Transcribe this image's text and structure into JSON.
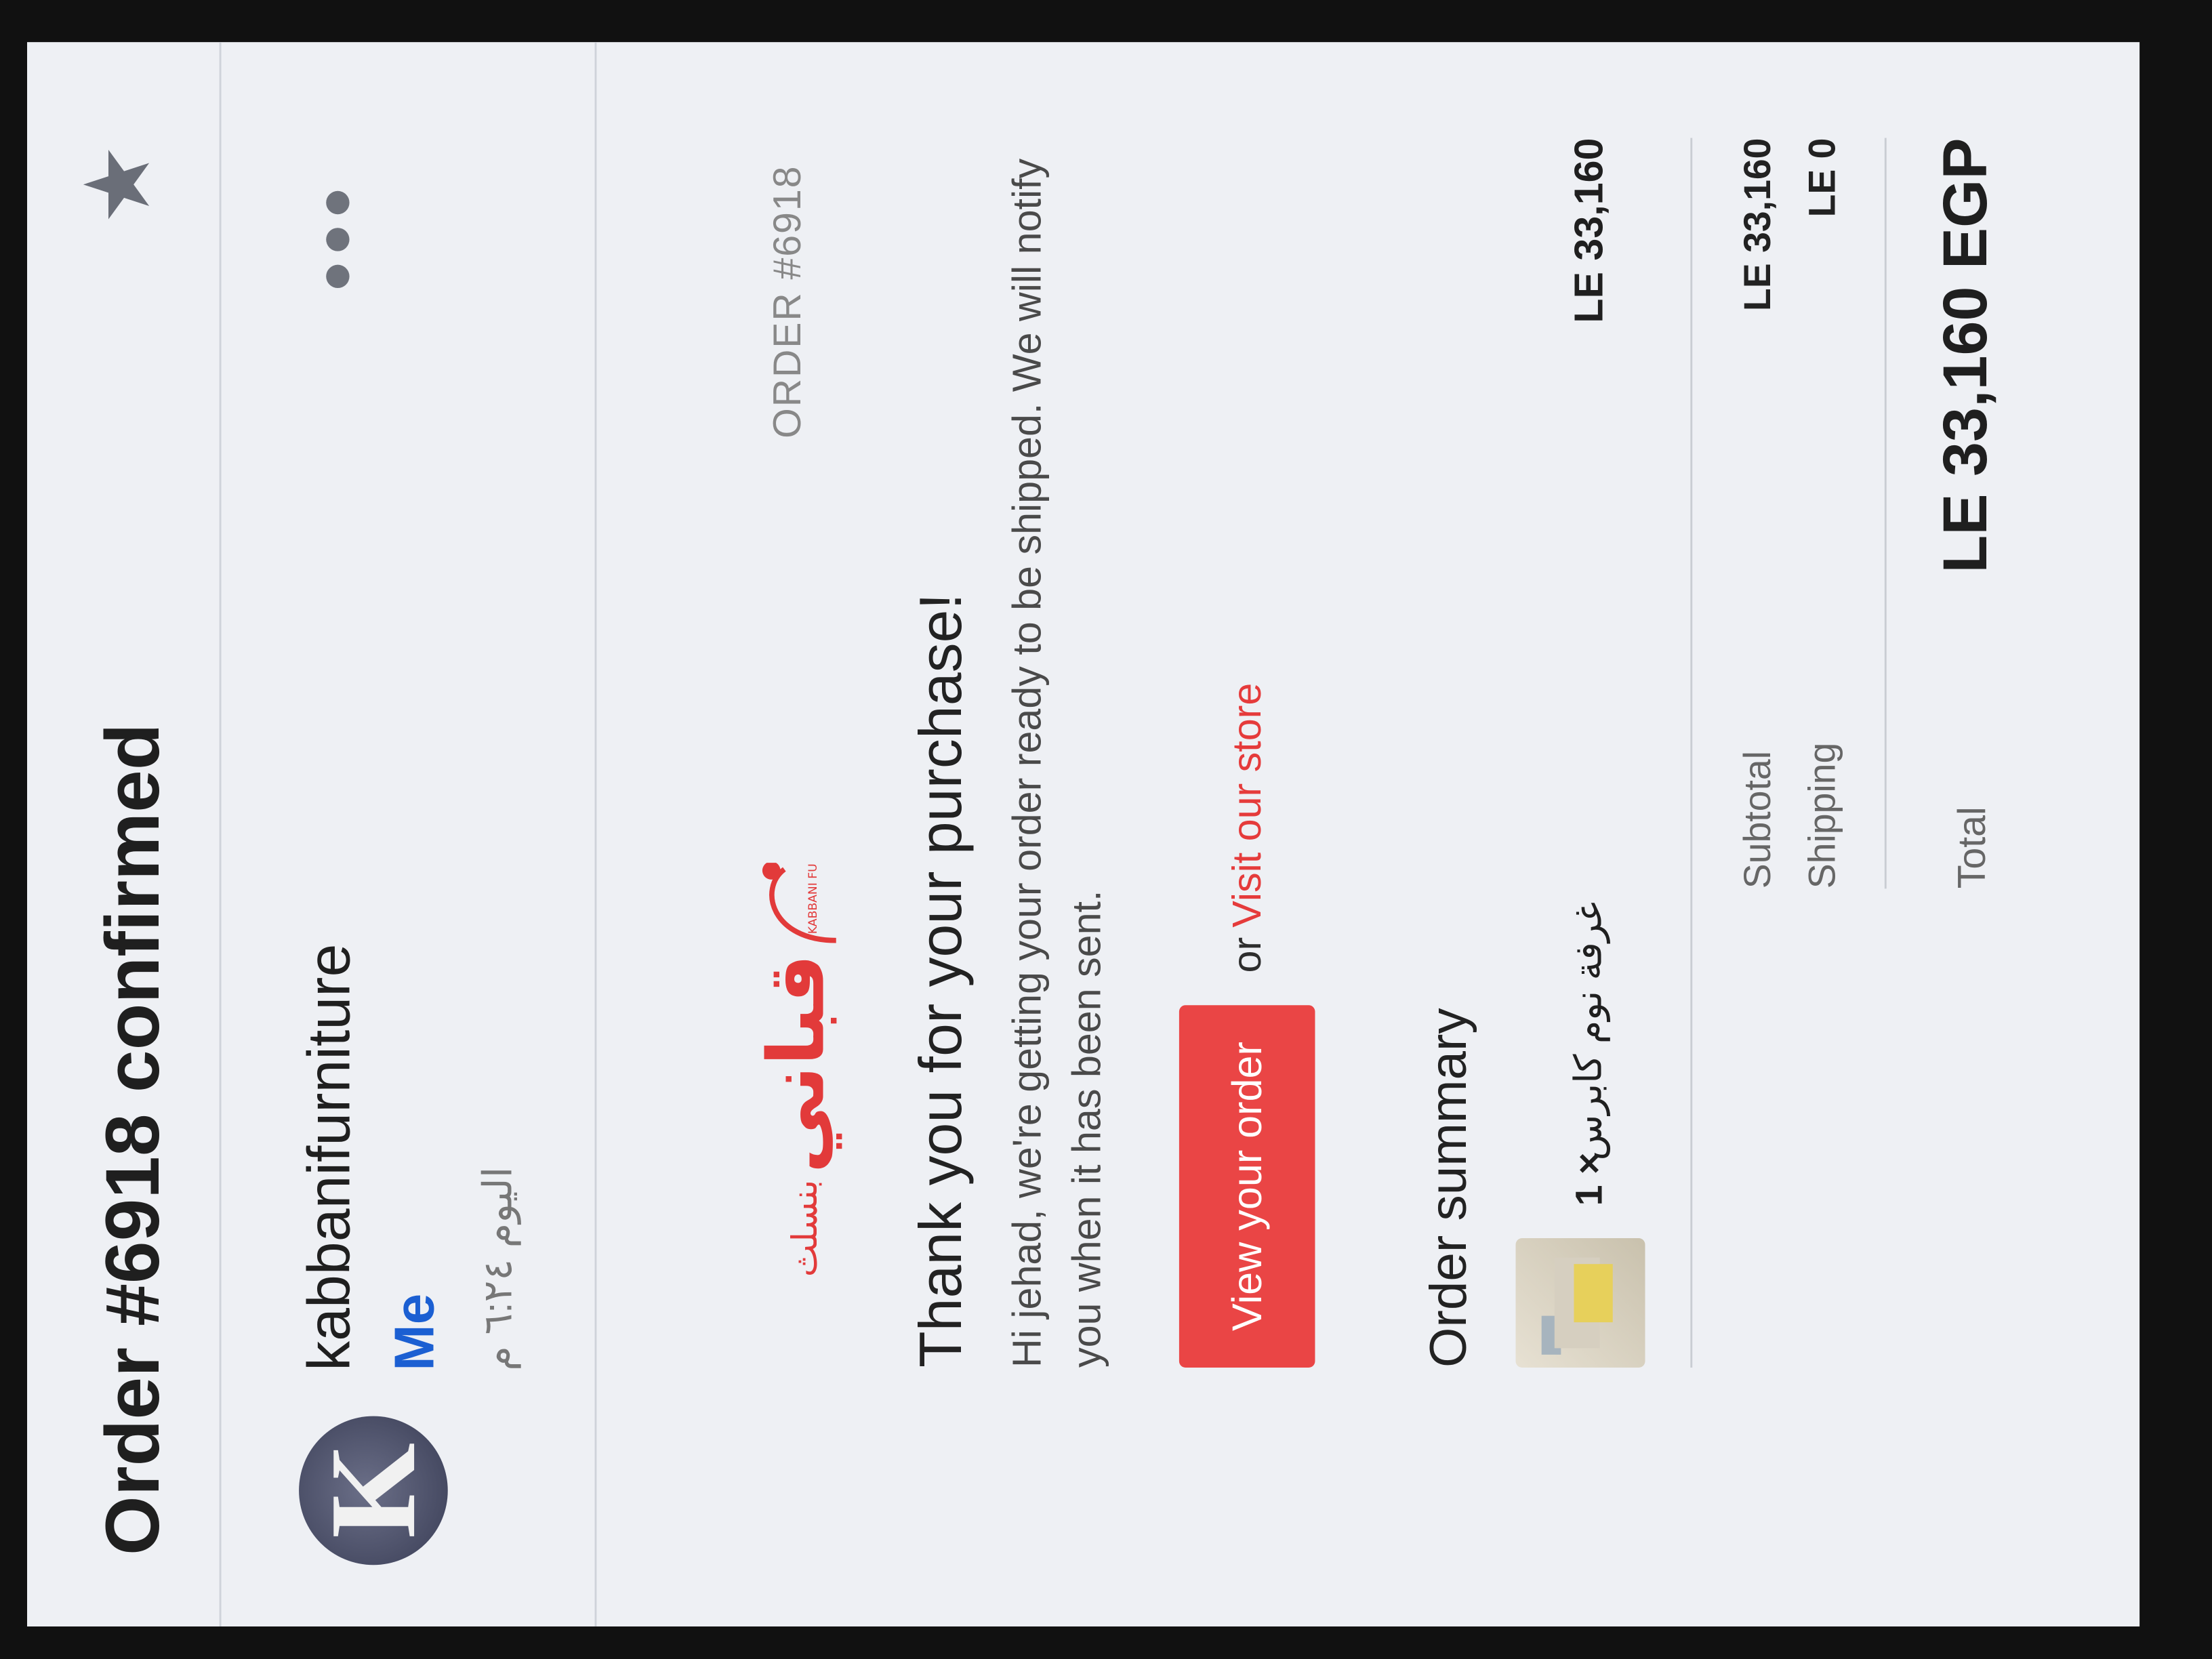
{
  "email": {
    "subject": "Order #6918 confirmed",
    "sender_name": "kabbanifurniture",
    "avatar_letter": "K",
    "recipient": "Me",
    "date": "اليوم ٦:٢٤ م"
  },
  "brand": {
    "logo_arabic": "قباني",
    "logo_arabic_suffix": "بنسلث",
    "logo_english": "KABBANI FURNITURE",
    "accent_color": "#ea4545"
  },
  "order": {
    "number_label": "ORDER #6918",
    "thanks_heading": "Thank you for your purchase!",
    "message": "Hi jehad, we're getting your order ready to be shipped. We will notify you when it has been sent.",
    "view_order_label": "View your order",
    "or_text": "or",
    "visit_store_label": "Visit our store"
  },
  "summary": {
    "title": "Order summary",
    "items": [
      {
        "quantity": "1 ×",
        "name": "غرفة نوم كابرس",
        "price": "LE 33,160"
      }
    ],
    "subtotal_label": "Subtotal",
    "subtotal_value": "LE 33,160",
    "shipping_label": "Shipping",
    "shipping_value": "LE 0",
    "total_label": "Total",
    "total_value": "LE 33,160 EGP"
  },
  "icons": {
    "star": "star-icon",
    "more": "more-options-icon"
  }
}
